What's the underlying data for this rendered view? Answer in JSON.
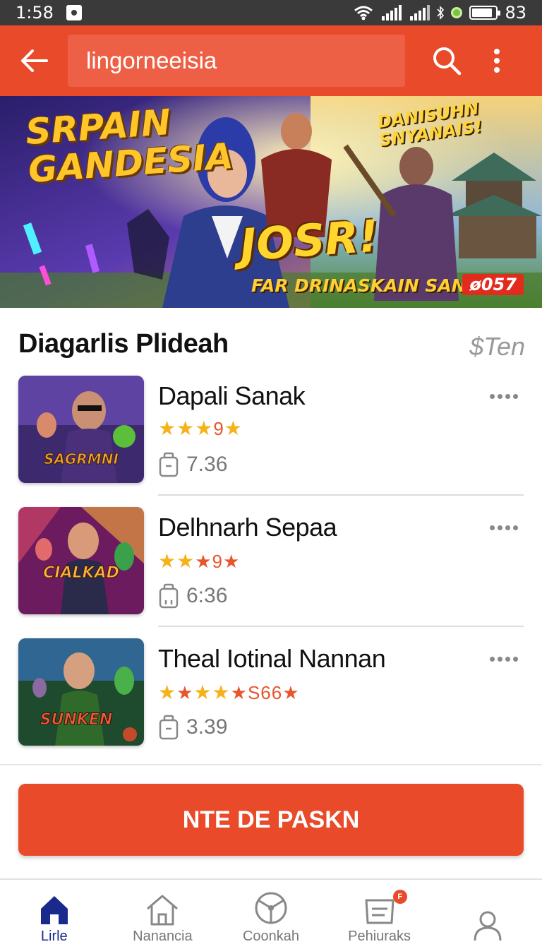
{
  "status_bar": {
    "time": "1:58",
    "battery": "83"
  },
  "app_bar": {
    "search_value": "lingorneeisia"
  },
  "banner": {
    "title_line1": "SRPAIN",
    "title_line2": "GANDESIA",
    "tag_line1": "DANISUHN",
    "tag_line2": "SNYANAIS!",
    "main_text": "JOSR!",
    "sub_text": "FAR DRINASKAIN SAN",
    "badge": "057"
  },
  "section": {
    "title": "Diagarlis Plideah",
    "link": "$Ten"
  },
  "games": [
    {
      "name": "Dapali Sanak",
      "rating_text": "9",
      "size": "7.36",
      "thumb_text": "SAGRMNI",
      "colors": [
        "#3d2a6e",
        "#8a4fc2",
        "#f0a22c"
      ]
    },
    {
      "name": "Delhnarh Sepaa",
      "rating_text": "9",
      "size": "6:36",
      "thumb_text": "CIALKAD",
      "colors": [
        "#6b1b5e",
        "#e04d6a",
        "#ffb23b"
      ]
    },
    {
      "name": "Theal Iotinal Nannan",
      "rating_text": "S66",
      "size": "3.39",
      "thumb_text": "SUNKEN",
      "colors": [
        "#1e4a2e",
        "#3a7bd5",
        "#c44a2a"
      ]
    }
  ],
  "cta": {
    "label": "NTE DE PASKN"
  },
  "bottom_nav": [
    {
      "label": "Lirle",
      "icon": "home-filled-icon",
      "active": true
    },
    {
      "label": "Nanancia",
      "icon": "home-outline-icon",
      "active": false
    },
    {
      "label": "Coonkah",
      "icon": "steering-wheel-icon",
      "active": false
    },
    {
      "label": "Pehiuraks",
      "icon": "inbox-icon",
      "active": false,
      "badge": "F"
    },
    {
      "label": "",
      "icon": "profile-icon",
      "active": false
    }
  ],
  "colors": {
    "accent": "#e84a2a",
    "star": "#f6b21b",
    "nav_active": "#1a2a8c"
  }
}
